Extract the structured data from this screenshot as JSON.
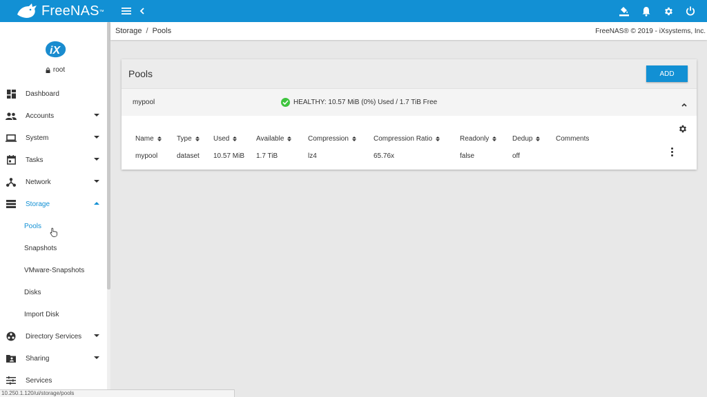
{
  "app": {
    "brand": "FreeNAS",
    "trademark": "™"
  },
  "topbar": {
    "icons": [
      "menu-icon",
      "chevron-left-icon",
      "theme-icon",
      "bell-icon",
      "gear-icon",
      "power-icon"
    ]
  },
  "sidebar": {
    "user": "root",
    "items": [
      {
        "label": "Dashboard",
        "icon": "dashboard-icon"
      },
      {
        "label": "Accounts",
        "icon": "people-icon"
      },
      {
        "label": "System",
        "icon": "laptop-icon"
      },
      {
        "label": "Tasks",
        "icon": "calendar-icon"
      },
      {
        "label": "Network",
        "icon": "network-icon"
      },
      {
        "label": "Storage",
        "icon": "storage-icon"
      },
      {
        "label": "Directory Services",
        "icon": "directory-icon"
      },
      {
        "label": "Sharing",
        "icon": "folder-share-icon"
      },
      {
        "label": "Services",
        "icon": "tune-icon"
      }
    ],
    "storage_sub": [
      "Pools",
      "Snapshots",
      "VMware-Snapshots",
      "Disks",
      "Import Disk"
    ]
  },
  "breadcrumb": {
    "root": "Storage",
    "sep": "/",
    "current": "Pools"
  },
  "copyright": "FreeNAS® © 2019 - iXsystems, Inc.",
  "card": {
    "title": "Pools",
    "add_label": "ADD",
    "pool_name": "mypool",
    "pool_status": "HEALTHY: 10.57 MiB (0%) Used / 1.7 TiB Free",
    "columns": [
      "Name",
      "Type",
      "Used",
      "Available",
      "Compression",
      "Compression Ratio",
      "Readonly",
      "Dedup",
      "Comments"
    ],
    "row": [
      "mypool",
      "dataset",
      "10.57 MiB",
      "1.7 TiB",
      "lz4",
      "65.76x",
      "false",
      "off",
      ""
    ]
  },
  "statusbar": {
    "url": "10.250.1.120/ui/storage/pools"
  },
  "colors": {
    "accent": "#1290d4",
    "healthy": "#3ec43e"
  }
}
